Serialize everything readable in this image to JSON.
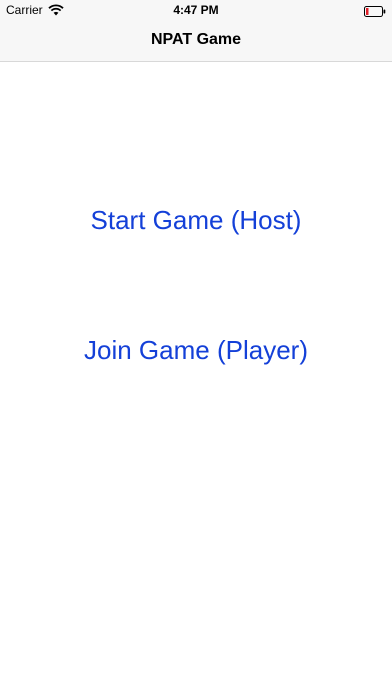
{
  "status_bar": {
    "carrier": "Carrier",
    "time": "4:47 PM",
    "icons": [
      "wifi-icon",
      "battery-icon"
    ],
    "battery_color": "#e0202a"
  },
  "nav_bar": {
    "title": "NPAT Game"
  },
  "main": {
    "start_label": "Start Game (Host)",
    "join_label": "Join Game (Player)"
  },
  "colors": {
    "accent": "#1440d8",
    "nav_background": "#f7f7f7"
  }
}
